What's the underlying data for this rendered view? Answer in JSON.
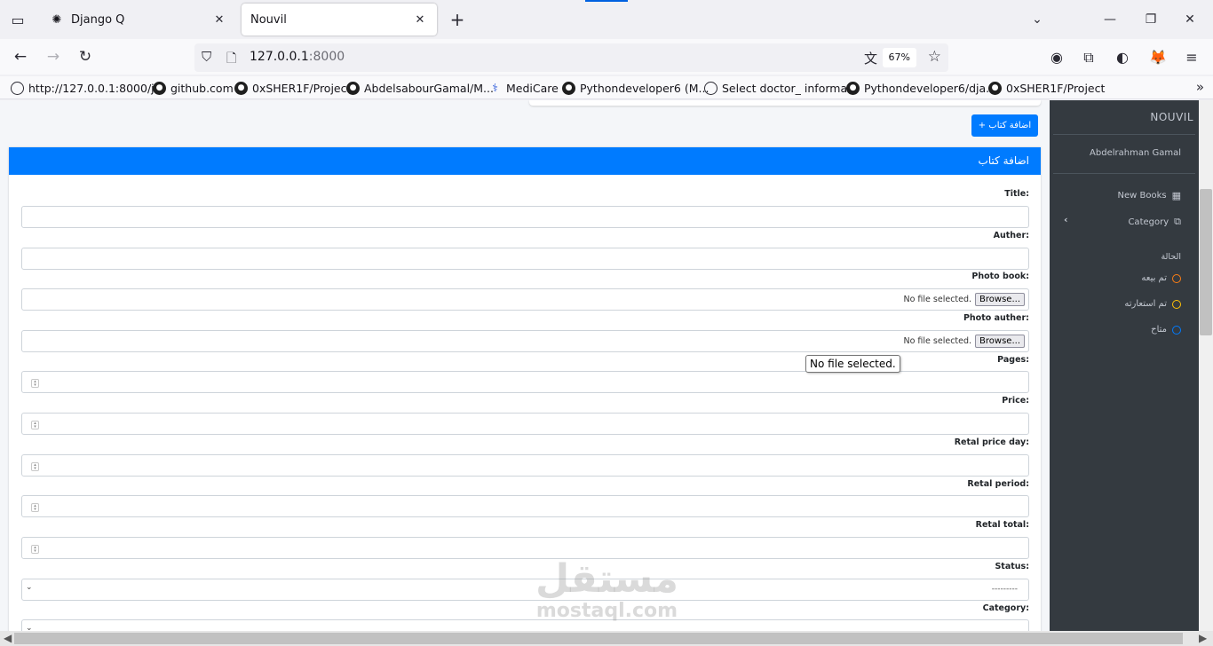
{
  "browser": {
    "tabs": [
      {
        "title": "Django Q",
        "active": false
      },
      {
        "title": "Nouvil",
        "active": true
      }
    ],
    "url_host": "127.0.0.1",
    "url_port": ":8000",
    "zoom": "67%",
    "bookmarks": [
      "http://127.0.0.1:8000/j...",
      "github.com",
      "0xSHER1F/Project",
      "AbdelsabourGamal/M...",
      "MediCare",
      "Pythondeveloper6 (M...",
      "Select doctor_ informa...",
      "Pythondeveloper6/dja...",
      "0xSHER1F/Project"
    ]
  },
  "page": {
    "add_button": "+ اضافة كتاب",
    "card_title": "اضافة كتاب",
    "fields": [
      {
        "label": "Title:",
        "type": "text"
      },
      {
        "label": "Auther:",
        "type": "text"
      },
      {
        "label": "Photo book:",
        "type": "file"
      },
      {
        "label": "Photo auther:",
        "type": "file"
      },
      {
        "label": "Pages:",
        "type": "number"
      },
      {
        "label": "Price:",
        "type": "number"
      },
      {
        "label": "Retal price day:",
        "type": "number"
      },
      {
        "label": "Retal period:",
        "type": "number"
      },
      {
        "label": "Retal total:",
        "type": "number"
      },
      {
        "label": "Status:",
        "type": "select"
      },
      {
        "label": "Category:",
        "type": "select"
      }
    ],
    "file_browse_label": "Browse...",
    "file_status": "No file selected.",
    "tooltip": "No file selected.",
    "select_placeholder": "---------",
    "watermark_ar": "مستقل",
    "watermark_en": "mostaql.com"
  },
  "sidebar": {
    "brand": "NOUVIL",
    "user": "Abdelrahman Gamal",
    "nav": [
      {
        "label": "New Books",
        "icon": "grid-icon"
      },
      {
        "label": "Category",
        "icon": "copy-icon"
      }
    ],
    "status_header": "الحالة",
    "statuses": [
      {
        "label": "تم بيعه",
        "color": "#fd7e14"
      },
      {
        "label": "تم استعارته",
        "color": "#ffc107"
      },
      {
        "label": "متاح",
        "color": "#007bff"
      }
    ]
  }
}
